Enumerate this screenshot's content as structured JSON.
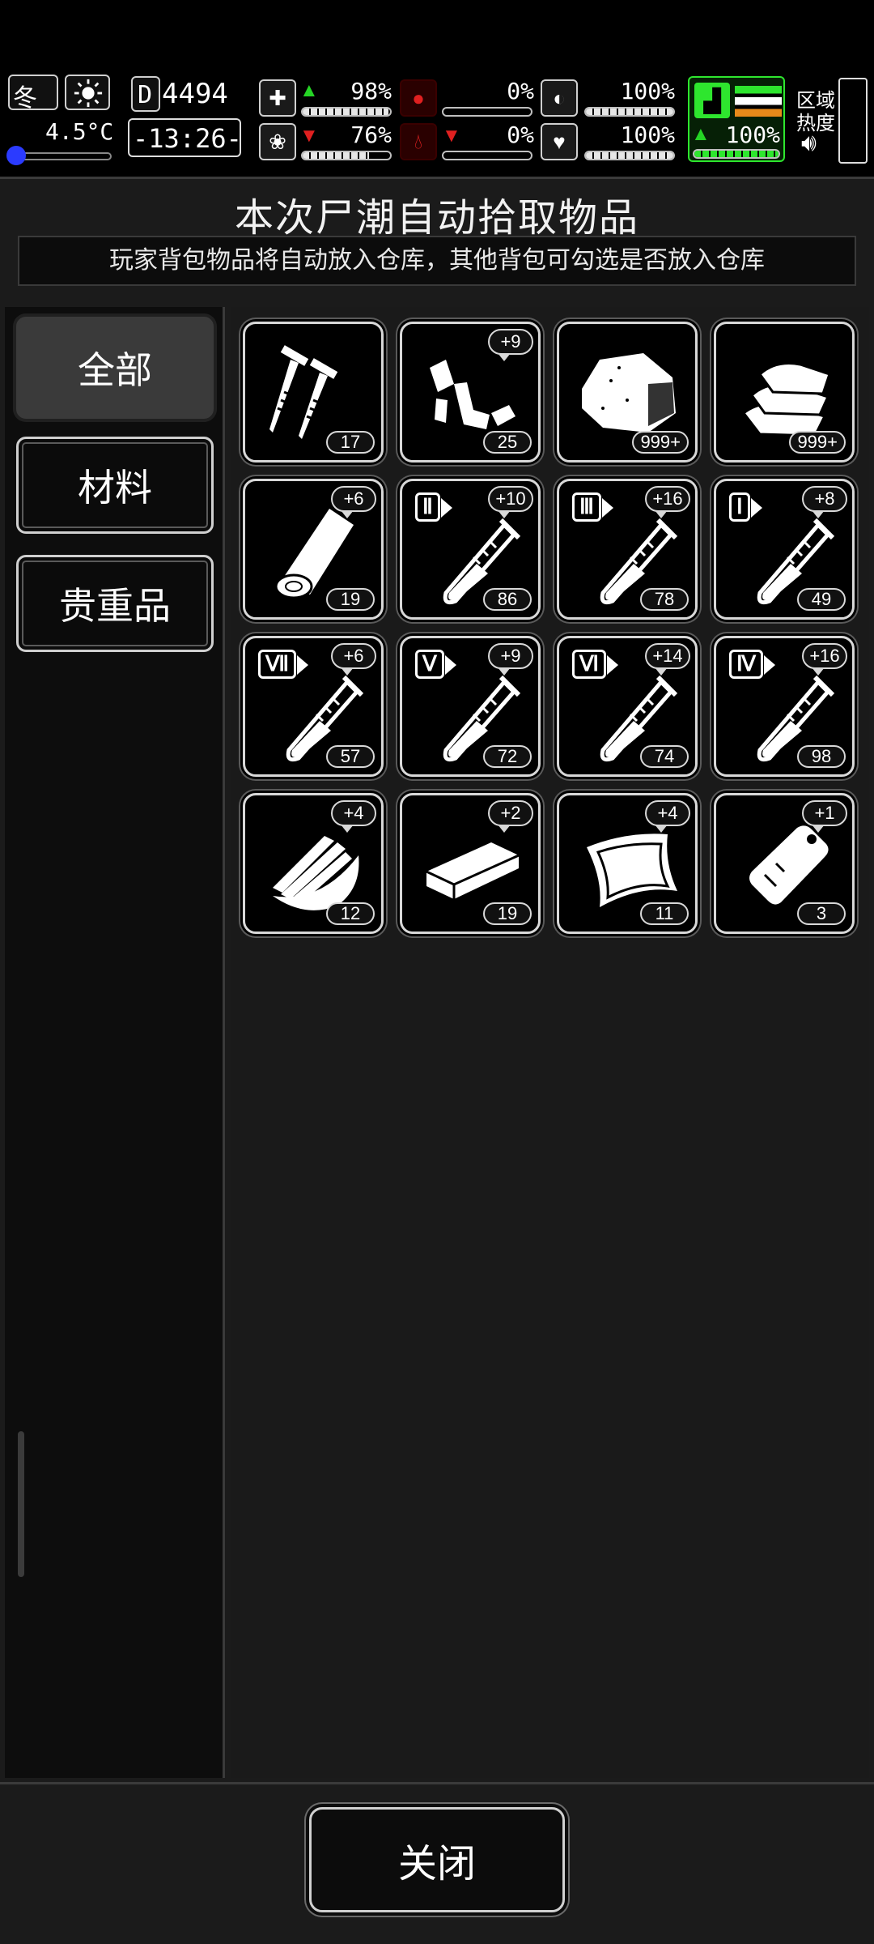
{
  "hud": {
    "season": "冬",
    "temperature": "4.5°C",
    "money_prefix": "D",
    "money": "4494",
    "clock": "-13:26-",
    "stats": {
      "health": "98%",
      "hunger": "0%",
      "stomach": "100%",
      "sanity": "76%",
      "thirst": "0%",
      "heart": "100%",
      "stamina": "100%"
    },
    "bar_levels": {
      "health": 0.98,
      "hunger": 0,
      "stomach": 1.0,
      "sanity": 0.76,
      "thirst": 0,
      "heart": 1.0,
      "stamina": 1.0
    },
    "region_label_1": "区域",
    "region_label_2": "热度"
  },
  "panel": {
    "title": "本次尸潮自动拾取物品",
    "notice": "玩家背包物品将自动放入仓库，其他背包可勾选是否放入仓库"
  },
  "tabs": [
    {
      "label": "全部",
      "active": true
    },
    {
      "label": "材料",
      "active": false
    },
    {
      "label": "贵重品",
      "active": false
    }
  ],
  "items": [
    {
      "icon": "nails-icon",
      "count": "17",
      "plus": ""
    },
    {
      "icon": "scrap-metal-icon",
      "count": "25",
      "plus": "+9"
    },
    {
      "icon": "ore-rock-icon",
      "count": "999+",
      "plus": ""
    },
    {
      "icon": "cloth-stack-icon",
      "count": "999+",
      "plus": ""
    },
    {
      "icon": "wood-log-icon",
      "count": "19",
      "plus": "+6"
    },
    {
      "icon": "test-tube-icon",
      "roman": "Ⅱ",
      "count": "86",
      "plus": "+10"
    },
    {
      "icon": "test-tube-icon",
      "roman": "Ⅲ",
      "count": "78",
      "plus": "+16"
    },
    {
      "icon": "test-tube-icon",
      "roman": "Ⅰ",
      "count": "49",
      "plus": "+8"
    },
    {
      "icon": "test-tube-icon",
      "roman": "Ⅶ",
      "count": "57",
      "plus": "+6"
    },
    {
      "icon": "test-tube-icon",
      "roman": "Ⅴ",
      "count": "72",
      "plus": "+9"
    },
    {
      "icon": "test-tube-icon",
      "roman": "Ⅵ",
      "count": "74",
      "plus": "+14"
    },
    {
      "icon": "test-tube-icon",
      "roman": "Ⅳ",
      "count": "98",
      "plus": "+16"
    },
    {
      "icon": "wood-planks-icon",
      "count": "12",
      "plus": "+4"
    },
    {
      "icon": "wood-board-icon",
      "count": "19",
      "plus": "+2"
    },
    {
      "icon": "leather-icon",
      "count": "11",
      "plus": "+4"
    },
    {
      "icon": "plastic-bag-icon",
      "count": "3",
      "plus": "+1"
    }
  ],
  "bottom": {
    "close_label": "关闭"
  }
}
